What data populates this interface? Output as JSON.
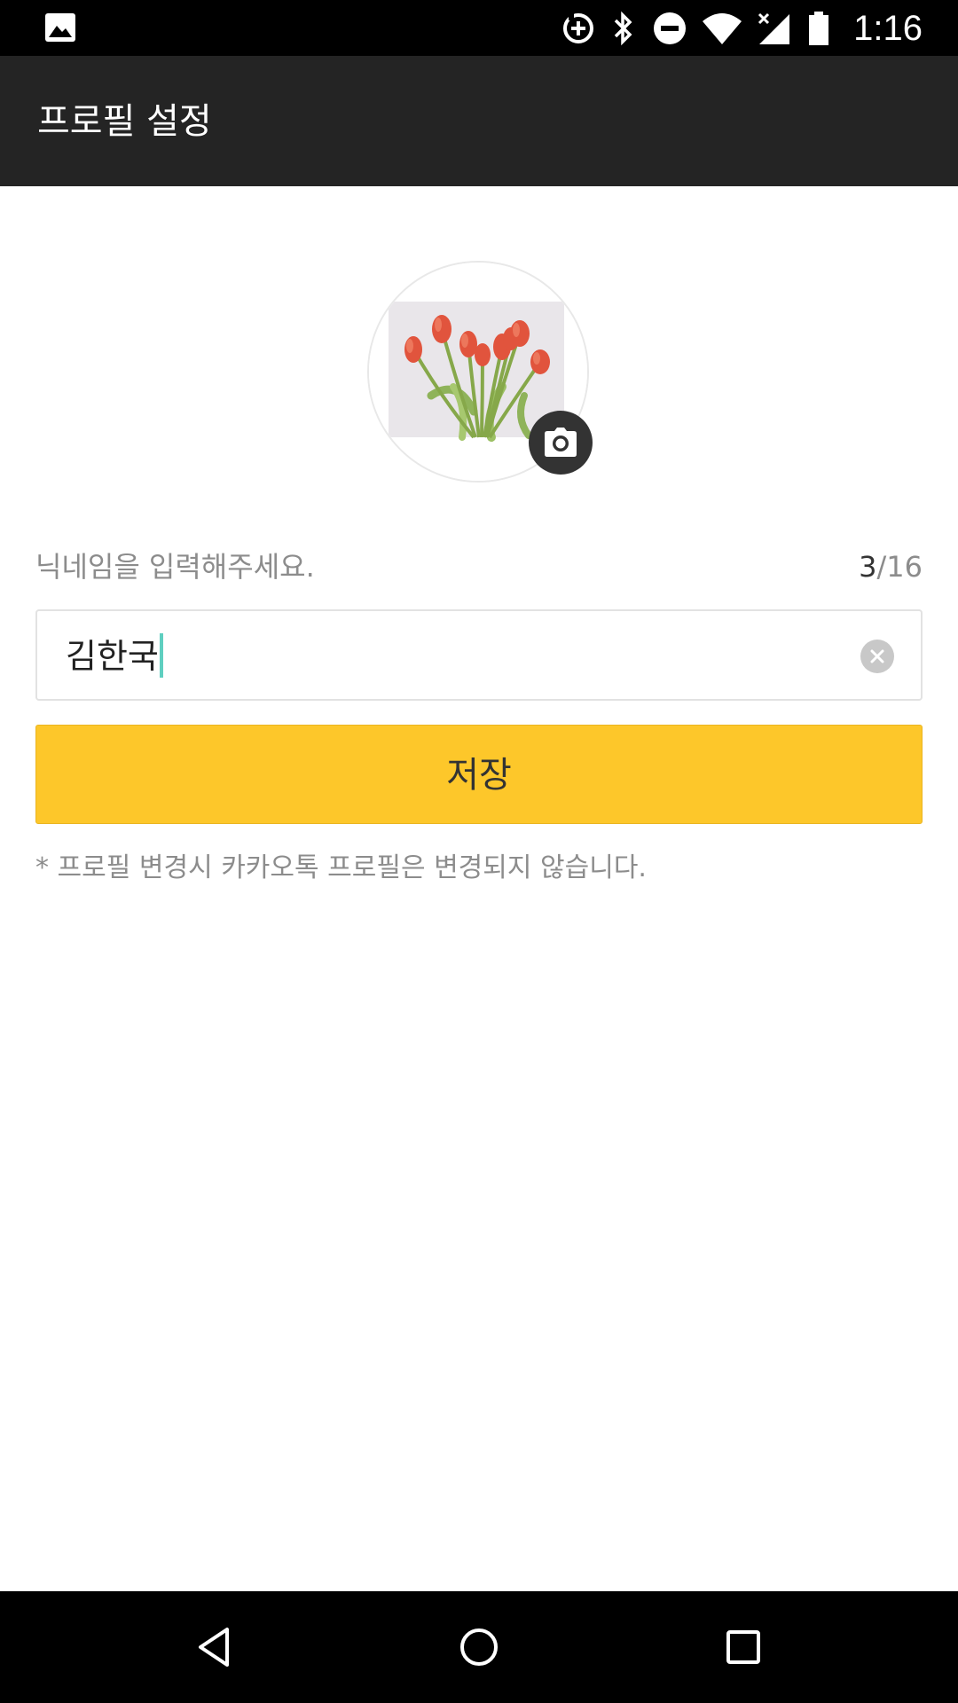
{
  "status_bar": {
    "time": "1:16",
    "icons": [
      "gallery-icon",
      "data-saver-icon",
      "bluetooth-icon",
      "do-not-disturb-icon",
      "wifi-icon",
      "cellular-no-data-icon",
      "battery-icon"
    ]
  },
  "app_bar": {
    "title": "프로필 설정"
  },
  "profile": {
    "avatar_alt": "tulip profile photo",
    "camera_icon": "camera-icon"
  },
  "nickname": {
    "label": "닉네임을 입력해주세요.",
    "value": "김한국",
    "count_current": "3",
    "count_max": "/16",
    "clear_icon": "clear-icon"
  },
  "save_button": {
    "label": "저장"
  },
  "notice": "* 프로필 변경시 카카오톡 프로필은 변경되지 않습니다.",
  "nav_bar": {
    "icons": [
      "back-icon",
      "home-icon",
      "recents-icon"
    ]
  },
  "colors": {
    "app_bar": "#242424",
    "accent": "#fdc72a",
    "cursor": "#5fcfc0",
    "muted_text": "#8c8c8c"
  }
}
